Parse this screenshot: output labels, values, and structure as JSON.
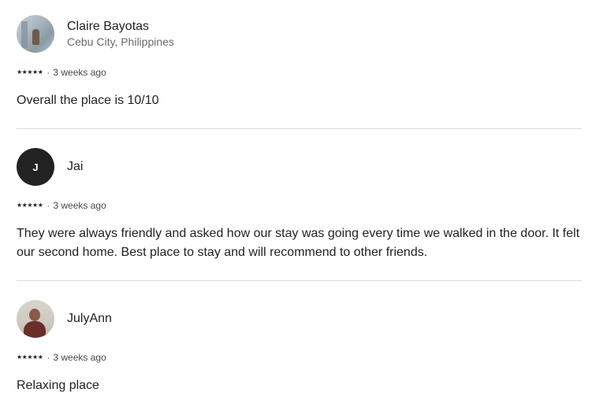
{
  "reviews": [
    {
      "name": "Claire Bayotas",
      "location": "Cebu City, Philippines",
      "avatar_type": "photo",
      "rating": 5,
      "date": "3 weeks ago",
      "text": "Overall the place is 10/10"
    },
    {
      "name": "Jai",
      "avatar_initial": "J",
      "avatar_type": "initial",
      "rating": 5,
      "date": "3 weeks ago",
      "text": "They were always friendly and asked how our stay was going every time we walked in the door. It felt our second home. Best place to stay and will recommend to other friends."
    },
    {
      "name": "JulyAnn",
      "avatar_type": "photo",
      "rating": 5,
      "date": "3 weeks ago",
      "text": "Relaxing place"
    }
  ],
  "separator": "·",
  "star_glyph": "★",
  "colors": {
    "text_primary": "#222222",
    "text_secondary": "#6a6a6a",
    "divider": "#dddddd",
    "initial_avatar_bg": "#222222"
  }
}
